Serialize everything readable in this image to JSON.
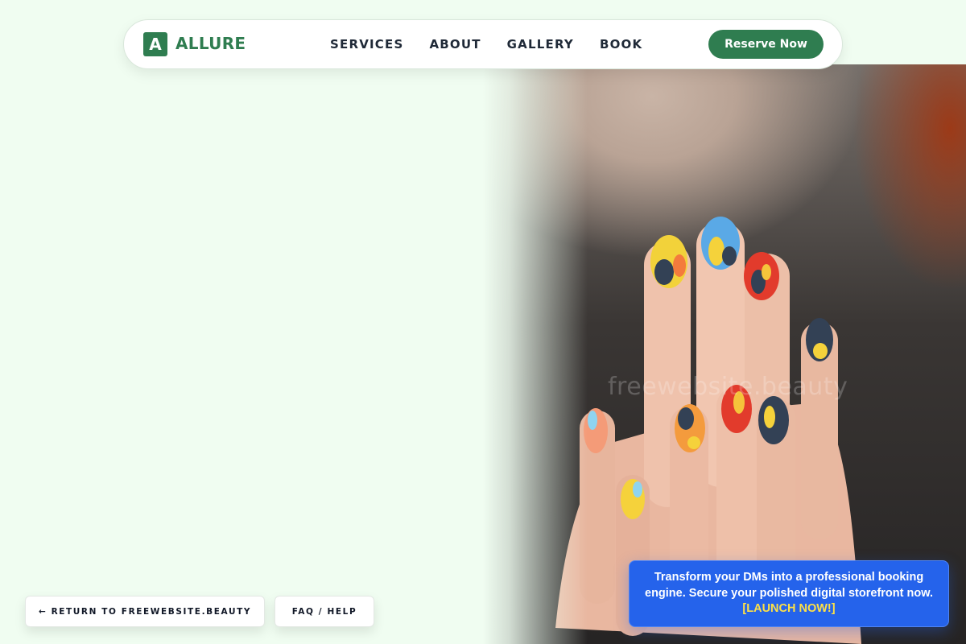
{
  "brand": {
    "logo_letter": "A",
    "name": "ALLURE",
    "accent_color": "#2f7d50"
  },
  "nav": {
    "items": [
      {
        "label": "SERVICES"
      },
      {
        "label": "ABOUT"
      },
      {
        "label": "GALLERY"
      },
      {
        "label": "BOOK"
      }
    ],
    "cta_label": "Reserve Now"
  },
  "hero": {
    "image": "hands-with-colorful-painted-nails-photo",
    "watermark": "freewebsite.beauty"
  },
  "footer_buttons": {
    "return_label": "← RETURN TO FREEWEBSITE.BEAUTY",
    "faq_label": "FAQ / HELP"
  },
  "promo": {
    "text": "Transform your DMs into a professional booking engine. Secure your polished digital storefront now.",
    "link_label": "[LAUNCH NOW!]",
    "background_color": "#2563eb",
    "link_color": "#fde047"
  }
}
